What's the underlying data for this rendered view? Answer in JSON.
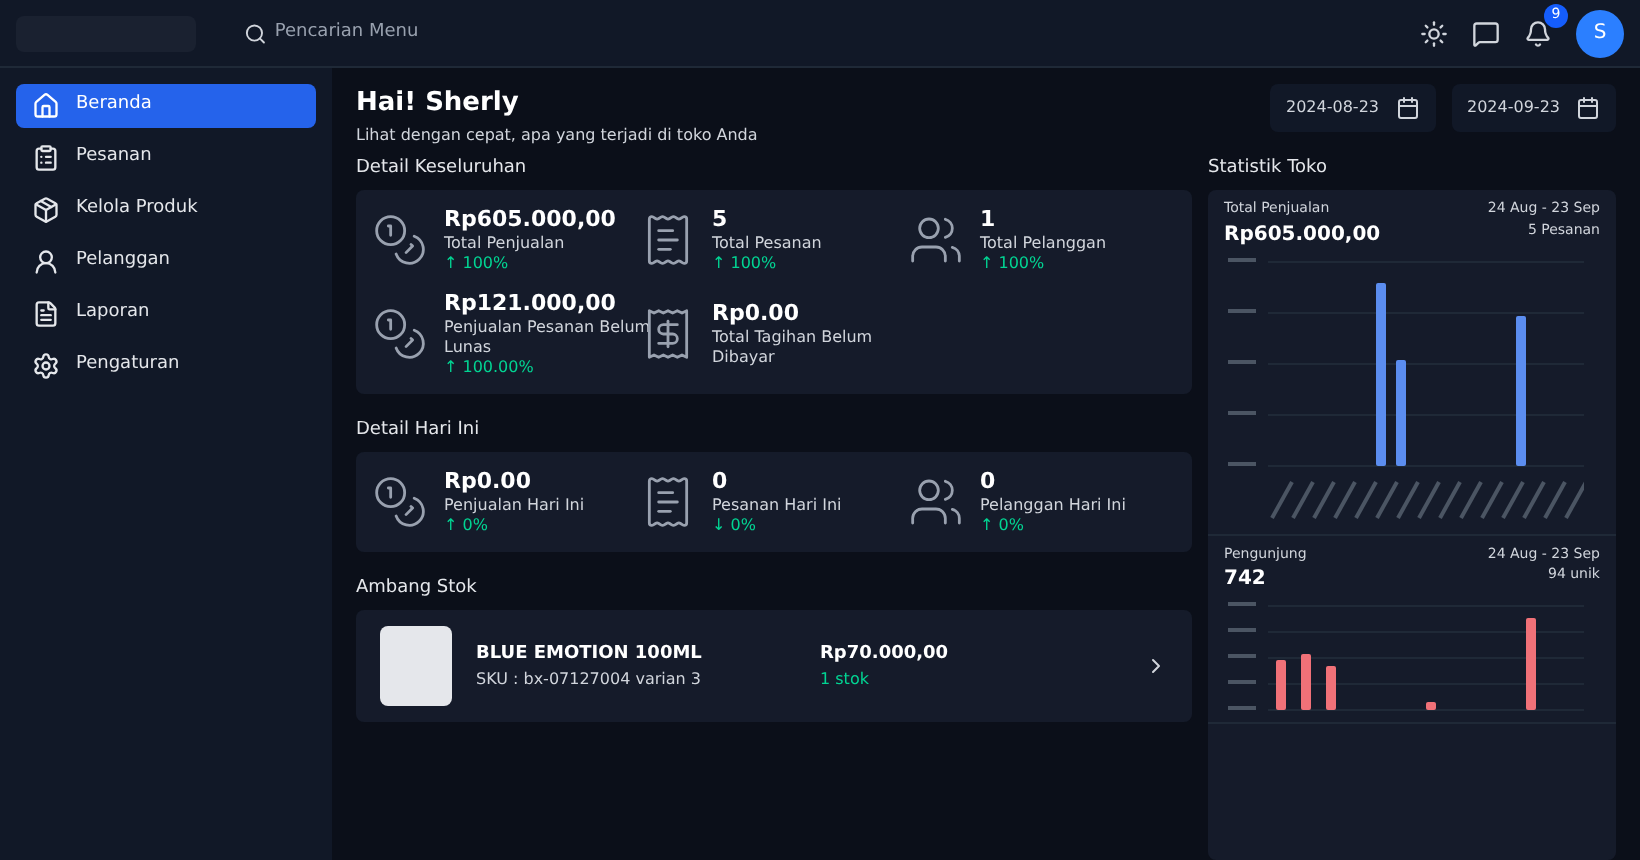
{
  "topbar": {
    "search": {
      "placeholder": "Pencarian Menu"
    },
    "notification_count": "9",
    "avatar": "S"
  },
  "sidebar": {
    "items": [
      {
        "label": "Beranda",
        "selected": true
      },
      {
        "label": "Pesanan",
        "selected": false
      },
      {
        "label": "Kelola Produk",
        "selected": false
      },
      {
        "label": "Pelanggan",
        "selected": false
      },
      {
        "label": "Laporan",
        "selected": false
      },
      {
        "label": "Pengaturan",
        "selected": false
      }
    ]
  },
  "header": {
    "title": "Hai! Sherly",
    "subtitle": "Lihat dengan cepat, apa yang terjadi di toko Anda",
    "date_from": "2024-08-23",
    "date_to": "2024-09-23"
  },
  "overall": {
    "title": "Detail Keseluruhan",
    "stats": [
      {
        "kind": "sales",
        "value": "Rp605.000,00",
        "label": "Total Penjualan",
        "change": "↑ 100%"
      },
      {
        "kind": "orders",
        "value": "5",
        "label": "Total Pesanan",
        "change": "↑ 100%"
      },
      {
        "kind": "customers",
        "value": "1",
        "label": "Total Pelanggan",
        "change": "↑ 100%"
      },
      {
        "kind": "sales",
        "value": "Rp121.000,00",
        "label": "Penjualan Pesanan Belum Lunas",
        "change": "↑ 100.00%"
      },
      {
        "kind": "bill",
        "value": "Rp0.00",
        "label": "Total Tagihan Belum Dibayar"
      }
    ]
  },
  "today": {
    "title": "Detail Hari Ini",
    "stats": [
      {
        "kind": "sales",
        "value": "Rp0.00",
        "label": "Penjualan Hari Ini",
        "change": "↑ 0%"
      },
      {
        "kind": "orders",
        "value": "0",
        "label": "Pesanan Hari Ini",
        "change": "↓ 0%"
      },
      {
        "kind": "customers",
        "value": "0",
        "label": "Pelanggan Hari Ini",
        "change": "↑ 0%"
      }
    ]
  },
  "stock": {
    "title": "Ambang Stok",
    "items": [
      {
        "name": "BLUE EMOTION 100ML",
        "sku": "SKU : bx-07127004 varian 3",
        "price": "Rp70.000,00",
        "qty": "1 stok"
      }
    ]
  },
  "stats": {
    "title": "Statistik Toko",
    "panels": [
      {
        "kind": "sales",
        "label": "Total Penjualan",
        "value": "Rp605.000,00",
        "range": "24 Aug - 23 Sep",
        "note": "5 Pesanan"
      },
      {
        "kind": "visitors",
        "label": "Pengunjung",
        "value": "742",
        "range": "24 Aug - 23 Sep",
        "note": "94 unik"
      }
    ]
  }
}
